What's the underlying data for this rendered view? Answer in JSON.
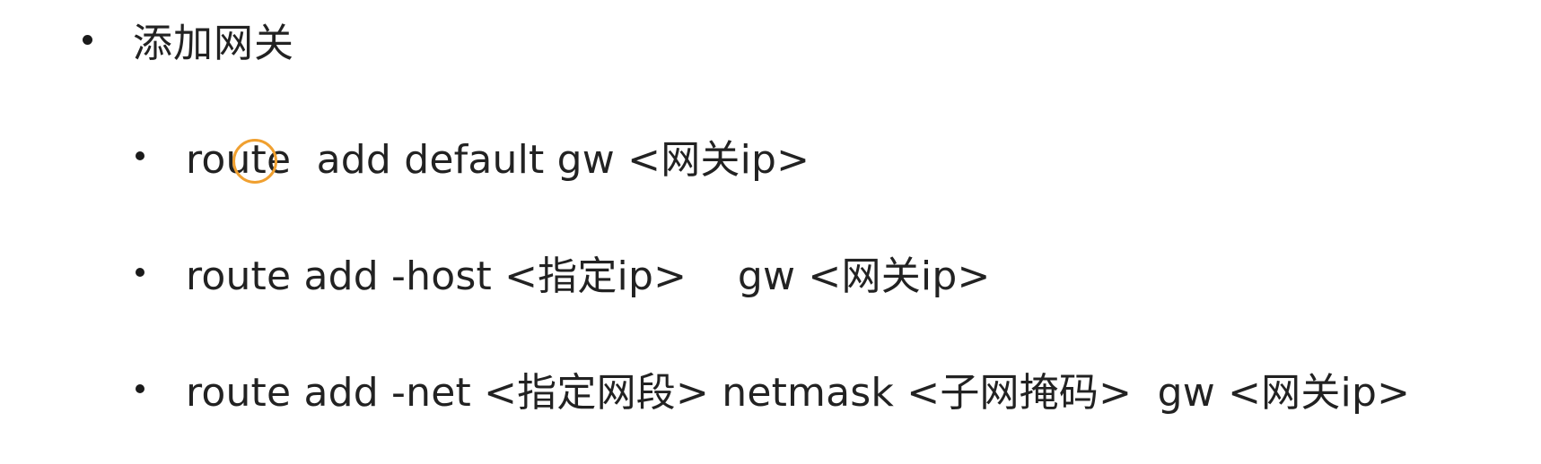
{
  "heading": {
    "text": "添加网关"
  },
  "commands": [
    {
      "text": "route  add default gw <网关ip>"
    },
    {
      "text": "route add -host <指定ip>    gw <网关ip>"
    },
    {
      "text": "route add -net <指定网段> netmask <子网掩码>  gw <网关ip>"
    }
  ],
  "colors": {
    "text": "#222222",
    "cursor_highlight": "#f0a030",
    "background": "#ffffff"
  }
}
